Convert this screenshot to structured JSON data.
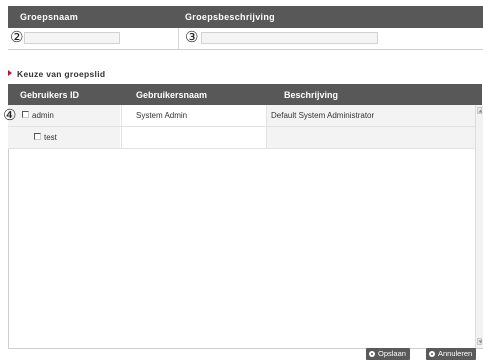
{
  "form": {
    "headers": {
      "group_name_label": "Groepsnaam",
      "group_desc_label": "Groepsbeschrijving"
    },
    "group_name_value": "",
    "group_desc_value": "",
    "markers": {
      "m2": "②",
      "m3": "③",
      "m4": "④"
    }
  },
  "section": {
    "title": "Keuze van groepslid"
  },
  "grid": {
    "columns": {
      "id": "Gebruikers ID",
      "name": "Gebruikersnaam",
      "desc": "Beschrijving"
    },
    "rows": [
      {
        "id": "admin",
        "name": "System Admin",
        "desc": "Default System Administrator",
        "checked": false
      },
      {
        "id": "test",
        "name": "",
        "desc": "",
        "checked": false
      }
    ]
  },
  "buttons": {
    "save": "Opslaan",
    "cancel": "Annuleren"
  },
  "colors": {
    "header_bg": "#585858",
    "accent": "#c8102e"
  }
}
